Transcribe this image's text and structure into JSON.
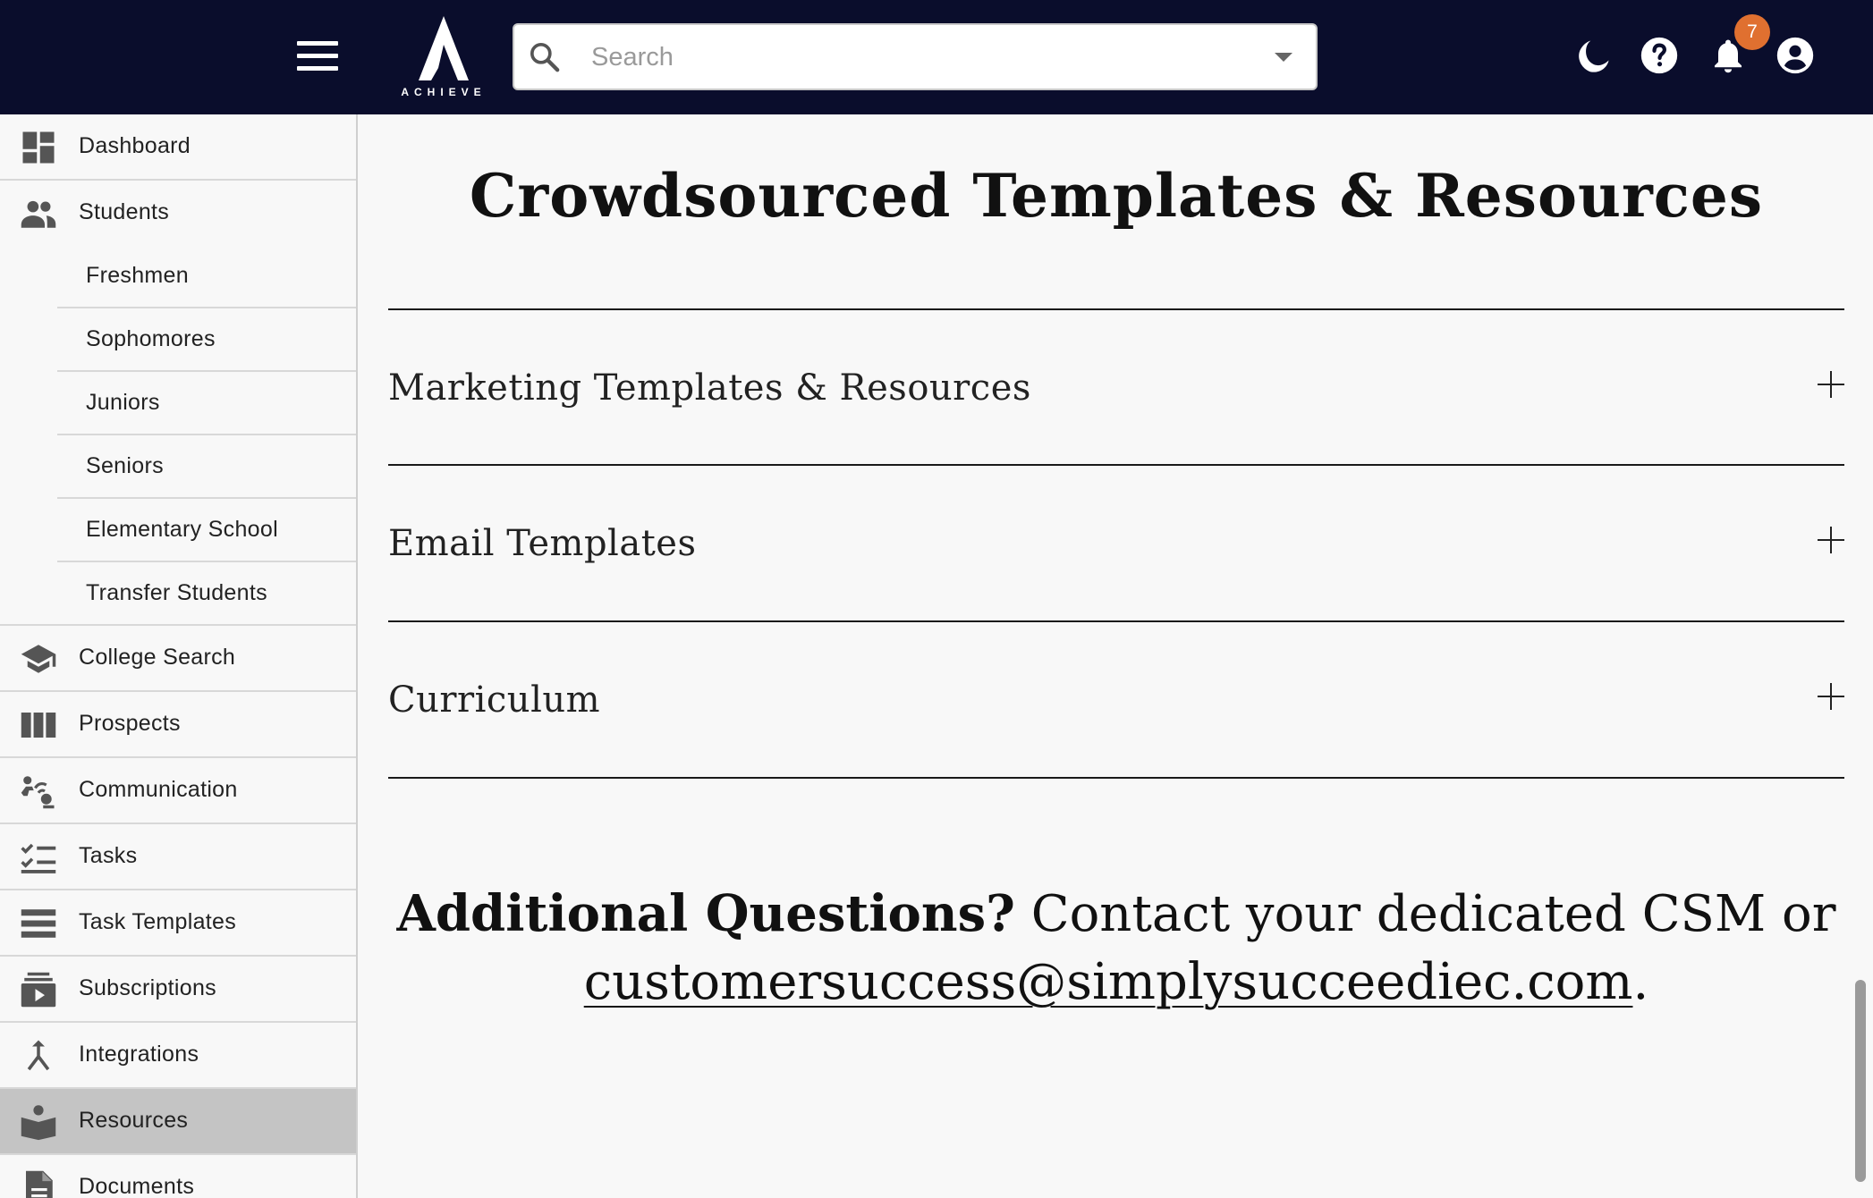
{
  "header": {
    "logo_text": "ACHIEVE",
    "search_placeholder": "Search",
    "notification_count": "7",
    "icons": [
      "menu-icon",
      "dark-mode-icon",
      "help-icon",
      "bell-icon",
      "account-icon"
    ]
  },
  "sidebar": {
    "items": [
      {
        "label": "Dashboard",
        "icon": "dashboard-icon"
      },
      {
        "label": "Students",
        "icon": "people-icon"
      },
      {
        "label": "College Search",
        "icon": "graduation-cap-icon"
      },
      {
        "label": "Prospects",
        "icon": "columns-icon"
      },
      {
        "label": "Communication",
        "icon": "communication-icon"
      },
      {
        "label": "Tasks",
        "icon": "checklist-icon"
      },
      {
        "label": "Task Templates",
        "icon": "list-icon"
      },
      {
        "label": "Subscriptions",
        "icon": "subscriptions-icon"
      },
      {
        "label": "Integrations",
        "icon": "merge-icon"
      },
      {
        "label": "Resources",
        "icon": "reader-icon",
        "active": true
      },
      {
        "label": "Documents",
        "icon": "document-icon"
      }
    ],
    "student_subitems": [
      "Freshmen",
      "Sophomores",
      "Juniors",
      "Seniors",
      "Elementary School",
      "Transfer Students"
    ]
  },
  "main": {
    "title": "Crowdsourced Templates & Resources",
    "sections": [
      "Marketing Templates & Resources",
      "Email Templates",
      "Curriculum"
    ],
    "contact": {
      "bold": "Additional Questions?",
      "text": " Contact your dedicated CSM or",
      "email": "customersuccess@simplysucceediec.com",
      "end": "."
    }
  },
  "colors": {
    "topbar": "#0a0d2c",
    "badge": "#e07030",
    "active_item": "#c4c4c4"
  }
}
